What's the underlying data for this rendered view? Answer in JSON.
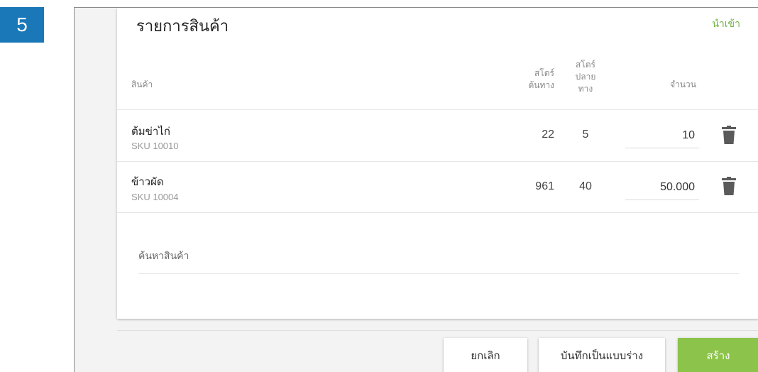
{
  "step": "5",
  "card": {
    "title": "รายการสินค้า",
    "import_link": "นำเข้า"
  },
  "table": {
    "headers": {
      "product": "สินค้า",
      "origin_store": [
        "สโตร์",
        "ต้นทาง"
      ],
      "dest_store": [
        "สโตร์",
        "ปลาย",
        "ทาง"
      ],
      "quantity": "จำนวน"
    },
    "rows": [
      {
        "name": "ต้มข่าไก่",
        "sku": "SKU 10010",
        "origin": "22",
        "dest": "5",
        "qty": "10"
      },
      {
        "name": "ข้าวผัด",
        "sku": "SKU 10004",
        "origin": "961",
        "dest": "40",
        "qty": "50.000"
      }
    ]
  },
  "search": {
    "placeholder": "ค้นหาสินค้า"
  },
  "buttons": {
    "cancel": "ยกเลิก",
    "save_draft": "บันทึกเป็นแบบร่าง",
    "create": "สร้าง"
  },
  "icons": {
    "delete": "trash-icon"
  },
  "colors": {
    "badge": "#1a78b8",
    "accent_green": "#8cc34a",
    "link_green": "#6cb33f"
  }
}
